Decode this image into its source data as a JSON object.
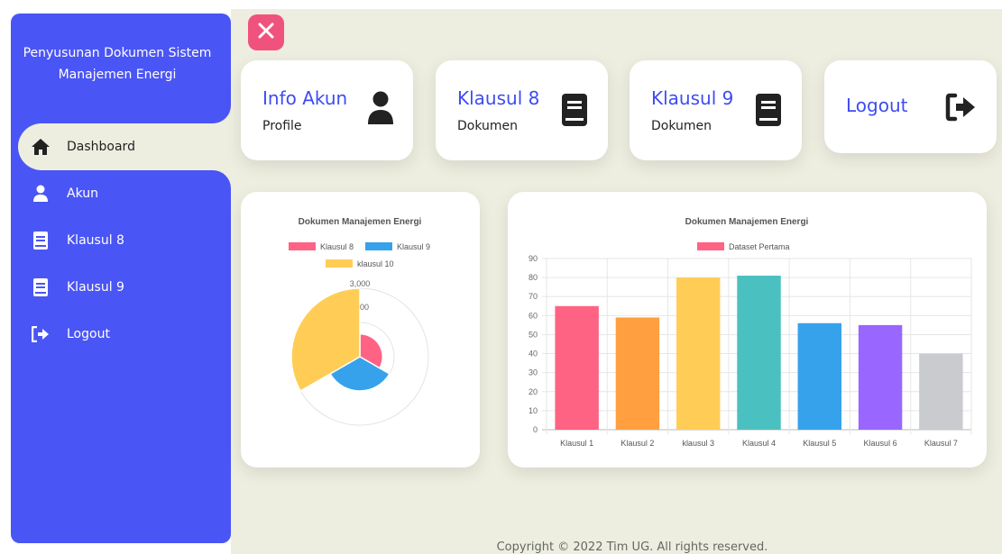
{
  "sidebar": {
    "title_line1": "Penyusunan Dokumen Sistem",
    "title_line2": "Manajemen Energi",
    "items": [
      {
        "label": "Dashboard",
        "icon": "home-icon",
        "active": true
      },
      {
        "label": "Akun",
        "icon": "user-icon"
      },
      {
        "label": "Klausul 8",
        "icon": "book-icon"
      },
      {
        "label": "Klausul 9",
        "icon": "book-icon"
      },
      {
        "label": "Logout",
        "icon": "sign-out-icon"
      }
    ]
  },
  "cards": [
    {
      "title": "Info Akun",
      "subtitle": "Profile",
      "icon": "user-icon"
    },
    {
      "title": "Klausul 8",
      "subtitle": "Dokumen",
      "icon": "book-icon"
    },
    {
      "title": "Klausul 9",
      "subtitle": "Dokumen",
      "icon": "book-icon"
    },
    {
      "title": "Logout",
      "subtitle": "",
      "icon": "sign-out-icon"
    }
  ],
  "colors": {
    "sidebar": "#4a55f5",
    "accent": "#3e4cf0",
    "close": "#f0527e",
    "background": "#eeeee0"
  },
  "footer": "Copyright © 2022 Tim UG. All rights reserved.",
  "chart_data": [
    {
      "type": "polarArea",
      "title": "Dokumen Manajemen Energi",
      "legend_position": "top",
      "categories": [
        "Klausul 8",
        "Klausul 9",
        "klausul 10"
      ],
      "values": [
        1000,
        1500,
        3000
      ],
      "colors": [
        "#ff6384",
        "#36a2eb",
        "#ffcd56"
      ],
      "tick_labels": [
        "3,000",
        "00"
      ]
    },
    {
      "type": "bar",
      "title": "Dokumen Manajemen Energi",
      "legend_position": "top",
      "series": [
        {
          "name": "Dataset Pertama",
          "values": [
            65,
            59,
            80,
            81,
            56,
            55,
            40
          ]
        }
      ],
      "categories": [
        "Klausul 1",
        "Klausul 2",
        "klausul 3",
        "Klausul 4",
        "Klausul 5",
        "Klausul 6",
        "Klausul 7"
      ],
      "colors": [
        "#ff6384",
        "#ff9f40",
        "#ffcd56",
        "#4bc0c0",
        "#36a2eb",
        "#9966ff",
        "#c9cbcf"
      ],
      "ylim": [
        0,
        90
      ],
      "yticks": [
        0,
        10,
        20,
        30,
        40,
        50,
        60,
        70,
        80,
        90
      ],
      "grid": true
    }
  ]
}
